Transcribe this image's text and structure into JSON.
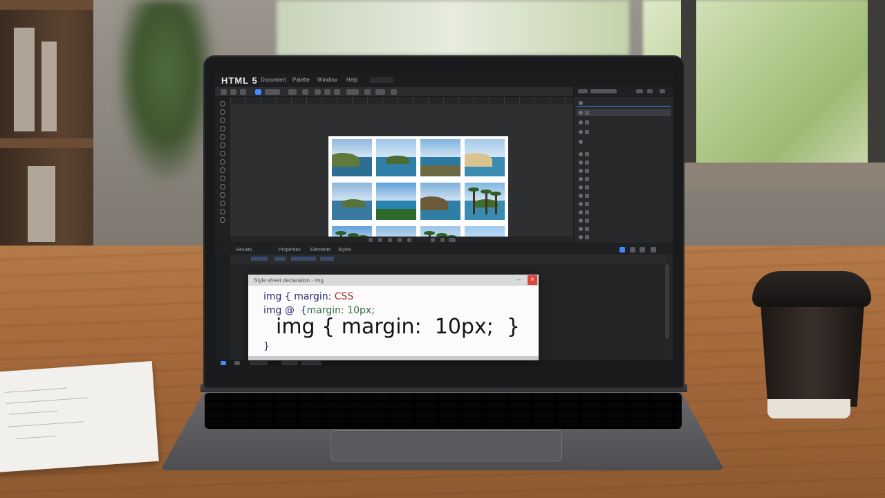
{
  "app": {
    "title": "HTML 5",
    "menu": [
      "Document",
      "Palette",
      "Window",
      "Help"
    ]
  },
  "gallery": {
    "thumbnails": [
      {
        "name": "coast-bay",
        "sky": "#8fb8de",
        "sea": "#2d6f93",
        "land": "#5f7a3c"
      },
      {
        "name": "island-clouds",
        "sky": "#9cc5ea",
        "sea": "#2f7fa8",
        "land": "#496b34"
      },
      {
        "name": "cove-cliffs",
        "sky": "#7fb2e0",
        "sea": "#2b7aa2",
        "land": "#6b6a45"
      },
      {
        "name": "sandy-beach",
        "sky": "#a4c9ea",
        "sea": "#3d8cb4",
        "land": "#d9c391"
      },
      {
        "name": "headland",
        "sky": "#8db6dc",
        "sea": "#3a7aa0",
        "land": "#57733c"
      },
      {
        "name": "green-islet",
        "sky": "#5d9fd8",
        "sea": "#2a86b0",
        "land": "#2f6a2c"
      },
      {
        "name": "rocky-point",
        "sky": "#7eb0da",
        "sea": "#2e7ea5",
        "land": "#6b5a3b"
      },
      {
        "name": "palm-shore",
        "sky": "#83b6e0",
        "sea": "#3a8bb0",
        "land": "#3f6c2a"
      },
      {
        "name": "palm-grove",
        "sky": "#5ea0dd",
        "sea": "#2f80ad",
        "land": "#3e6b2d"
      },
      {
        "name": "forest-coast",
        "sky": "#8fbbe2",
        "sea": "#2c79a3",
        "land": "#35612b"
      },
      {
        "name": "palm-path",
        "sky": "#9ec4e6",
        "sea": "#87a160",
        "land": "#4d6b31"
      },
      {
        "name": "open-sea",
        "sky": "#9cc8ee",
        "sea": "#3a89b6",
        "land": "#3a89b6"
      }
    ]
  },
  "bottom_panel": {
    "tabs": [
      "Results",
      "Properties",
      "Elements",
      "Styles"
    ]
  },
  "css_popup": {
    "title": "Style sheet declaration · img",
    "line1_prefix": "img { margin: ",
    "line1_keyword": "CSS",
    "line2_prefix": "img @  {",
    "line2_keyword": "margin: 10px;",
    "line3": "img { margin:  10px;  }",
    "closing_brace": "}",
    "close_label": "×",
    "minimize_label": "–"
  },
  "colors": {
    "accent": "#3f8cff",
    "close": "#e0413a",
    "editor_bg": "#252628"
  }
}
